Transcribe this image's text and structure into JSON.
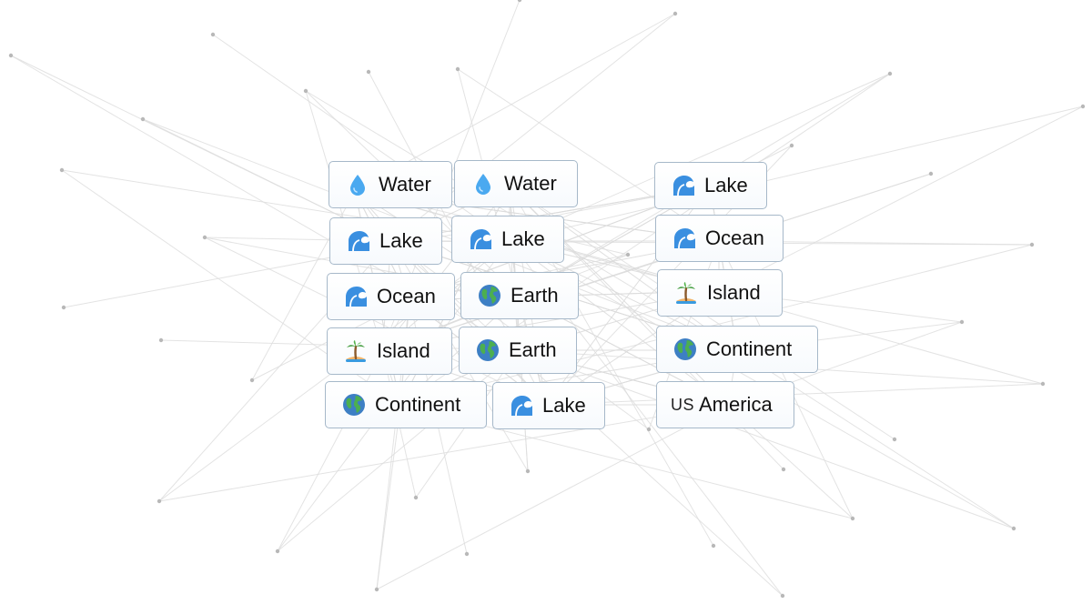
{
  "elements": [
    {
      "label": "Water",
      "icon": "water-drop-icon"
    },
    {
      "label": "Water",
      "icon": "water-drop-icon"
    },
    {
      "label": "Lake",
      "icon": "wave-icon"
    },
    {
      "label": "Lake",
      "icon": "wave-icon"
    },
    {
      "label": "Lake",
      "icon": "wave-icon"
    },
    {
      "label": "Ocean",
      "icon": "wave-icon"
    },
    {
      "label": "Ocean",
      "icon": "wave-icon"
    },
    {
      "label": "Earth",
      "icon": "globe-icon"
    },
    {
      "label": "Island",
      "icon": "palm-island-icon"
    },
    {
      "label": "Island",
      "icon": "palm-island-icon"
    },
    {
      "label": "Earth",
      "icon": "globe-icon"
    },
    {
      "label": "Continent",
      "icon": "globe-icon"
    },
    {
      "label": "Continent",
      "icon": "globe-icon"
    },
    {
      "label": "Lake",
      "icon": "wave-icon"
    },
    {
      "label": "America",
      "icon": "us-flag-icon",
      "icon_text": "US"
    }
  ],
  "colors": {
    "tile_border": "#a6b8c9",
    "line": "#dcdcdc",
    "dot": "#b8b8b8",
    "water": "#4aa9f0",
    "wave": "#3a8fe0",
    "globe_ocean": "#3d7fc4",
    "globe_land": "#4caf50"
  }
}
